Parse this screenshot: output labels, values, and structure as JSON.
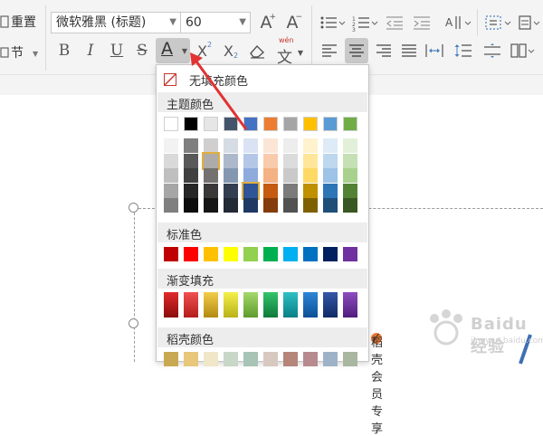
{
  "toolbar": {
    "reset_label": "重置",
    "section_label": "节",
    "font_name": "微软雅黑 (标题)",
    "font_size": "60",
    "grow_font": "A",
    "shrink_font": "A",
    "bold": "B",
    "italic": "I",
    "underline": "U",
    "strikethrough": "S",
    "font_color": "A",
    "superscript_base": "X",
    "subscript_base": "X",
    "pinyin_top": "wén",
    "pinyin_char": "文"
  },
  "color_panel": {
    "no_fill": "无填充颜色",
    "theme_title": "主题颜色",
    "standard_title": "标准色",
    "gradient_title": "渐变填充",
    "docer_title": "稻壳颜色",
    "docer_vip": "稻壳会员专享",
    "theme_top": [
      "#ffffff",
      "#000000",
      "#e7e6e6",
      "#44546a",
      "#4472c4",
      "#ed7d31",
      "#a5a5a5",
      "#ffc000",
      "#5b9bd5",
      "#70ad47"
    ],
    "theme_shades": [
      [
        "#f2f2f2",
        "#7f7f7f",
        "#d0cece",
        "#d6dce4",
        "#dae3f3",
        "#fbe5d6",
        "#ededed",
        "#fff2cc",
        "#deebf7",
        "#e2f0d9"
      ],
      [
        "#d9d9d9",
        "#595959",
        "#aeabab",
        "#adb9ca",
        "#b4c7e7",
        "#f8cbad",
        "#dbdbdb",
        "#ffe699",
        "#bdd7ee",
        "#c5e0b4"
      ],
      [
        "#bfbfbf",
        "#404040",
        "#757171",
        "#8497b0",
        "#8faadc",
        "#f4b183",
        "#c9c9c9",
        "#ffd966",
        "#9dc3e6",
        "#a9d18e"
      ],
      [
        "#a6a6a6",
        "#262626",
        "#3a3838",
        "#333f50",
        "#2f5597",
        "#c55a11",
        "#7b7b7b",
        "#bf9000",
        "#2e75b6",
        "#548235"
      ],
      [
        "#7f7f7f",
        "#0d0d0d",
        "#171616",
        "#222a35",
        "#203864",
        "#843c0c",
        "#525252",
        "#7f6000",
        "#1f4e79",
        "#385723"
      ]
    ],
    "standard": [
      "#c00000",
      "#ff0000",
      "#ffc000",
      "#ffff00",
      "#92d050",
      "#00b050",
      "#00b0f0",
      "#0070c0",
      "#002060",
      "#7030a0"
    ],
    "gradient": [
      [
        "#e02a2a",
        "#8a0c0c"
      ],
      [
        "#f05050",
        "#b51d1d"
      ],
      [
        "#f2cc4a",
        "#b38a12"
      ],
      [
        "#f5f04a",
        "#b8b21a"
      ],
      [
        "#a5d86c",
        "#5e9b2c"
      ],
      [
        "#35c46b",
        "#0e7a3a"
      ],
      [
        "#2ec0c4",
        "#087f86"
      ],
      [
        "#2d86d6",
        "#0c4f96"
      ],
      [
        "#3557a8",
        "#0f2a66"
      ],
      [
        "#8e4cc0",
        "#4f1d7c"
      ]
    ],
    "docer": [
      "#c8a850",
      "#e8c77a",
      "#f0e7c8",
      "#c9d7c8",
      "#a7c4b6",
      "#d7c9c0",
      "#b5857a",
      "#b78a8f",
      "#9fb3c8",
      "#a9b6a0"
    ]
  },
  "watermark": {
    "brand": "Baidu经验",
    "sub": "jingyan.baidu.com"
  }
}
